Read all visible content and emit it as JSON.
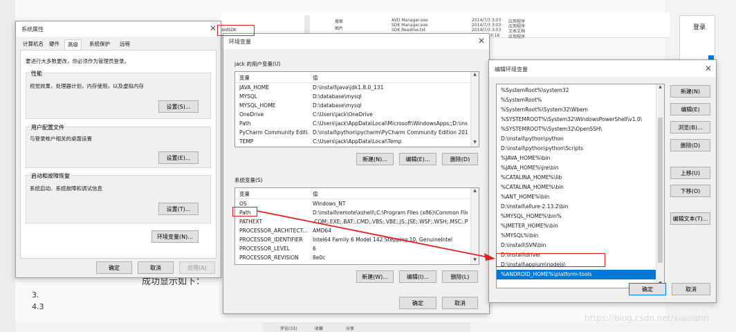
{
  "background": {
    "left_fragments": [
      "3.",
      "4.3"
    ],
    "mid_text": "成功显示如下：",
    "right_btn": "登录",
    "explorer_folder": "roidSDK",
    "explorer_nav": [
      "搜索",
      "图片",
      "文档"
    ],
    "explorer_files": [
      {
        "name": "AVD Manager.exe",
        "date": "2014/7/3 3:03",
        "type": "应用程序"
      },
      {
        "name": "SDK Manager.exe",
        "date": "2014/7/3 3:03",
        "type": "应用程序"
      },
      {
        "name": "SDK Readme.txt",
        "date": "2014/7/3 3:03",
        "type": "文本文档"
      },
      {
        "name": "",
        "date": "10:16",
        "type": "应用程序"
      }
    ],
    "watermark": "https://blog.csdn.net/xiaolanri",
    "bottom_bar": [
      "评论(33)",
      "收藏",
      "分享"
    ]
  },
  "sysprops": {
    "title": "系统属性",
    "tabs": [
      "计算机名",
      "硬件",
      "高级",
      "系统保护",
      "远程"
    ],
    "active_tab": 2,
    "admin_note": "要进行大多数更改，你必须作为管理员登录。",
    "perf": {
      "label": "性能",
      "desc": "视觉效果，处理器计划，内存使用，以及虚拟内存",
      "btn": "设置(S)..."
    },
    "profile": {
      "label": "用户配置文件",
      "desc": "与登录帐户相关的桌面设置",
      "btn": "设置(E)..."
    },
    "startup": {
      "label": "启动和故障恢复",
      "desc": "系统启动、系统故障和调试信息",
      "btn": "设置(T)..."
    },
    "env_btn": "环境变量(N)...",
    "ok": "确定",
    "cancel": "取消",
    "apply": "应用(A)"
  },
  "envvars": {
    "title": "环境变量",
    "user_group": "jack 的用户变量(U)",
    "col_var": "变量",
    "col_val": "值",
    "user_vars": [
      {
        "name": "JAVA_HOME",
        "value": "D:\\install\\java\\jdk1.8.0_131"
      },
      {
        "name": "MYSQL",
        "value": "D:\\database\\mysql"
      },
      {
        "name": "MYSQL_HOME",
        "value": "D:\\database\\mysql"
      },
      {
        "name": "OneDrive",
        "value": "C:\\Users\\jack\\OneDrive"
      },
      {
        "name": "Path",
        "value": "C:\\Users\\jack\\AppData\\Local\\Microsoft\\WindowsApps;;D:\\ins..."
      },
      {
        "name": "PyCharm Community Editi...",
        "value": "D:\\install\\python\\pycharm\\PyCharm Community Edition 2019...."
      },
      {
        "name": "TEMP",
        "value": "C:\\Users\\jack\\AppData\\Local\\Temp"
      }
    ],
    "user_btns": [
      "新建(N)...",
      "编辑(E)...",
      "删除(D)"
    ],
    "sys_group": "系统变量(S)",
    "sys_vars": [
      {
        "name": "OS",
        "value": "Windows_NT"
      },
      {
        "name": "Path",
        "value": "D:\\install\\remote\\xshell\\;C:\\Program Files (x86)\\Common Files..."
      },
      {
        "name": "PATHEXT",
        "value": ".COM;.EXE;.BAT;.CMD;.VBS;.VBE;.JS;.JSE;.WSF;.WSH;.MSC;.PY;.P..."
      },
      {
        "name": "PROCESSOR_ARCHITECT...",
        "value": "AMD64"
      },
      {
        "name": "PROCESSOR_IDENTIFIER",
        "value": "Intel64 Family 6 Model 142 Stepping 10, GenuineIntel"
      },
      {
        "name": "PROCESSOR_LEVEL",
        "value": "6"
      },
      {
        "name": "PROCESSOR_REVISION",
        "value": "8e0c"
      }
    ],
    "sys_btns": [
      "新建(W)...",
      "编辑(I)...",
      "删除(L)"
    ],
    "ok": "确定",
    "cancel": "取消"
  },
  "editenv": {
    "title": "编辑环境变量",
    "entries": [
      "%SystemRoot%\\system32",
      "%SystemRoot%",
      "%SystemRoot%\\System32\\Wbem",
      "%SYSTEMROOT%\\System32\\WindowsPowerShell\\v1.0\\",
      "%SYSTEMROOT%\\System32\\OpenSSH\\",
      "D:\\install\\python\\python",
      "D:\\install\\python\\python\\Scripts",
      "%JAVA_HOME%\\bin",
      "%JAVA_HOME%\\jre\\bin",
      "%CATALINA_HOME%\\lib",
      "%CATALINA_HOME%\\bin",
      "%ANT_HOME%\\bin",
      "D:\\install\\allure-2.13.2\\bin",
      "%MYSQL_HOME%\\bin%",
      "%JMETER_HOME%\\bin",
      "%MYSQL%\\bin",
      "D:\\install\\SVN\\bin",
      "D:\\install\\driver",
      "D:\\install\\appium\\nodejs\\",
      "%ANDROID_HOME%\\platform-tools"
    ],
    "selected_index": 19,
    "side_btns": [
      "新建(N)",
      "编辑(E)",
      "浏览(B)...",
      "删除(D)",
      "上移(U)",
      "下移(O)",
      "编辑文本(T)..."
    ],
    "ok": "确定",
    "cancel": "取消"
  },
  "colors": {
    "highlight": "#0078d7",
    "annotation": "#e02020"
  }
}
